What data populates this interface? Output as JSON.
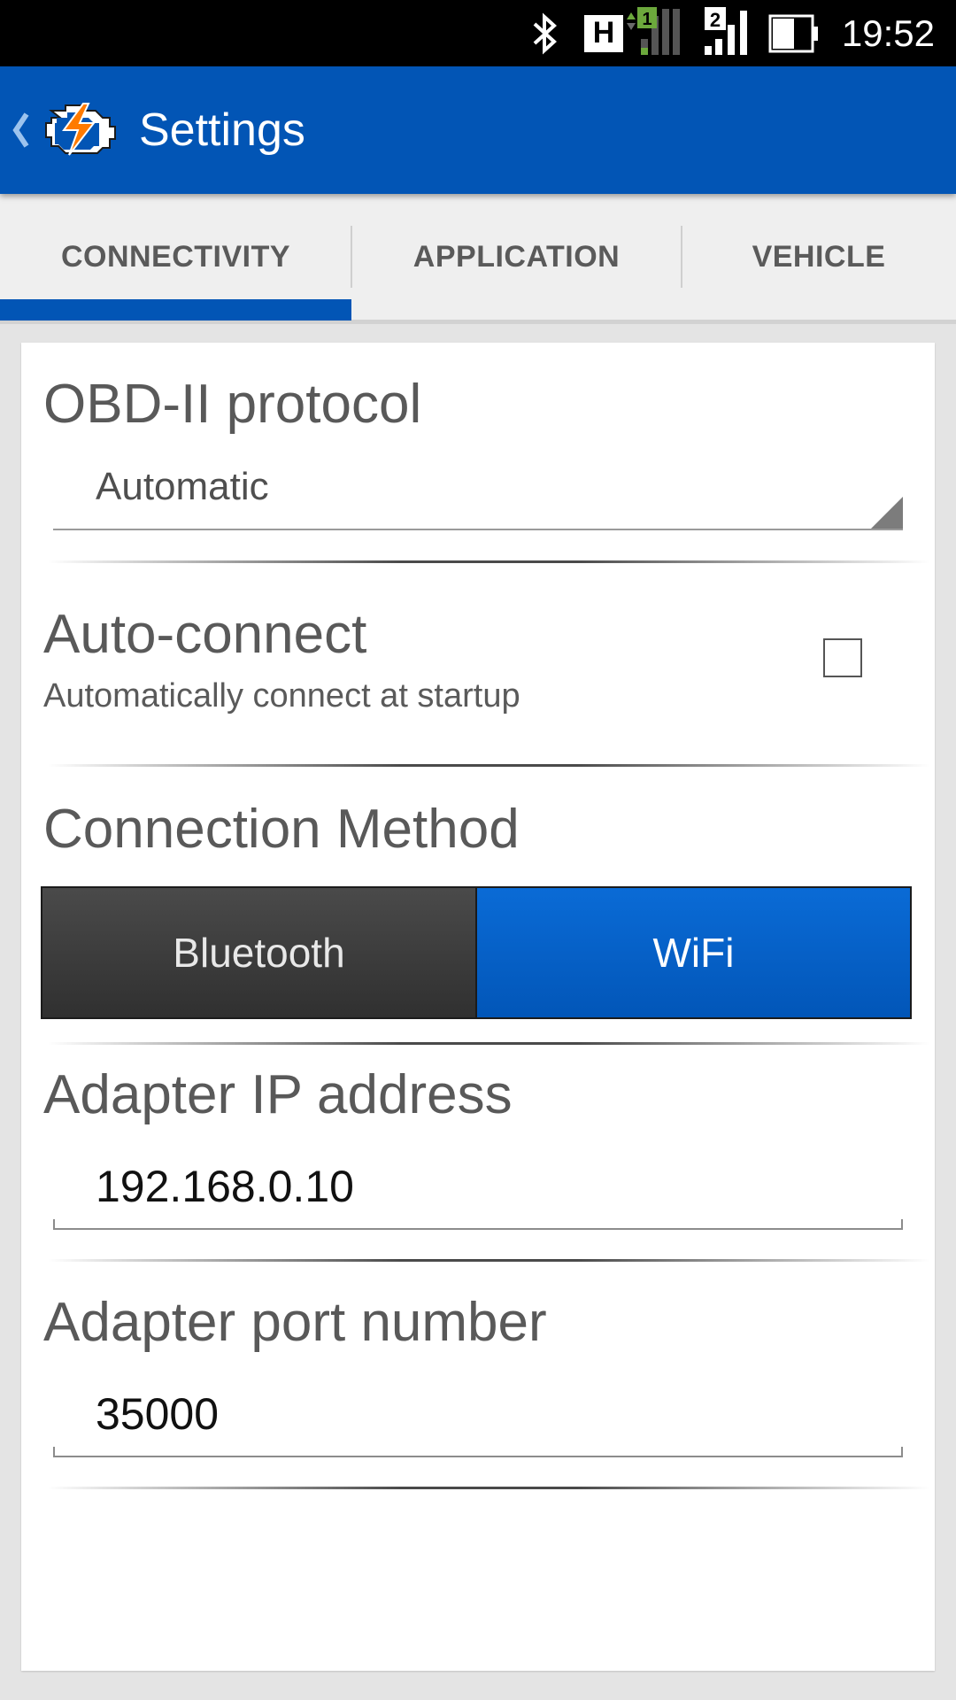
{
  "status_bar": {
    "time": "19:52",
    "network_label": "H",
    "sim1_label": "1",
    "sim2_label": "2",
    "icons": [
      "bluetooth-icon",
      "network-h-icon",
      "signal-sim1-icon",
      "signal-sim2-icon",
      "battery-icon"
    ]
  },
  "action_bar": {
    "title": "Settings",
    "app_icon": "engine-check-icon"
  },
  "tabs": [
    {
      "label": "CONNECTIVITY",
      "selected": true
    },
    {
      "label": "APPLICATION",
      "selected": false
    },
    {
      "label": "VEHICLE",
      "selected": false
    }
  ],
  "colors": {
    "primary": "#0255b5",
    "status_bar": "#000000",
    "wifi_selected": "#0a6bd6",
    "bluetooth_unselected": "#3a3a3a"
  },
  "preferences": {
    "protocol": {
      "title": "OBD-II protocol",
      "value": "Automatic"
    },
    "auto_connect": {
      "title": "Auto-connect",
      "summary": "Automatically connect at startup",
      "checked": false
    },
    "connection_method": {
      "title": "Connection Method",
      "options": [
        "Bluetooth",
        "WiFi"
      ],
      "selected": "WiFi"
    },
    "adapter_ip": {
      "title": "Adapter IP address",
      "value": "192.168.0.10"
    },
    "adapter_port": {
      "title": "Adapter port number",
      "value": "35000"
    }
  }
}
